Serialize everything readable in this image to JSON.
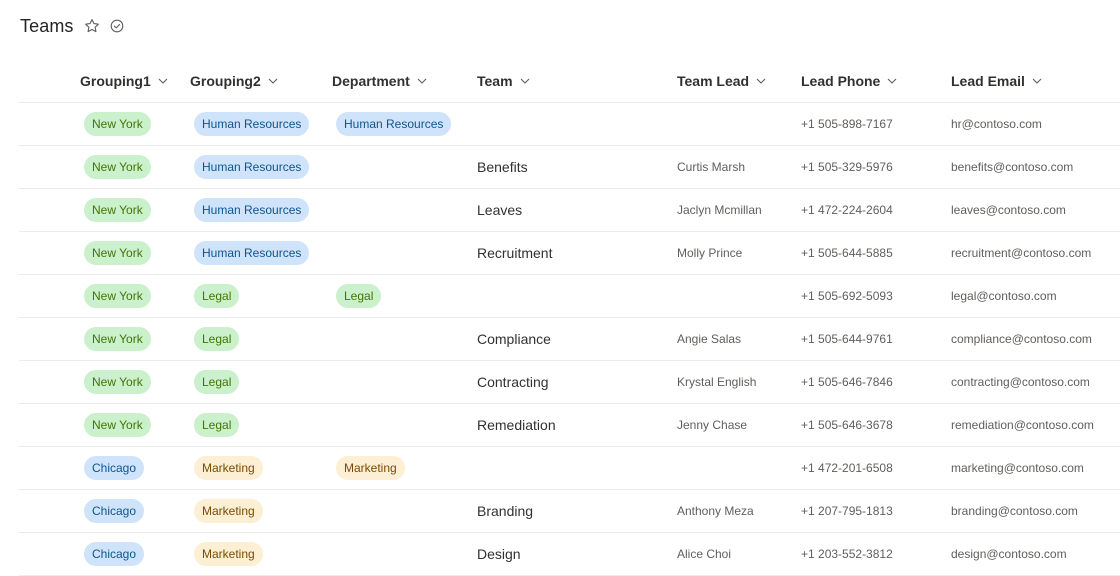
{
  "page": {
    "title": "Teams"
  },
  "columns": [
    "Grouping1",
    "Grouping2",
    "Department",
    "Team",
    "Team Lead",
    "Lead Phone",
    "Lead Email"
  ],
  "rows": [
    {
      "grouping1": {
        "text": "New York",
        "color": "green"
      },
      "grouping2": {
        "text": "Human Resources",
        "color": "blue"
      },
      "department": {
        "text": "Human Resources",
        "color": "blue"
      },
      "team": "",
      "lead": "",
      "phone": "+1 505-898-7167",
      "email": "hr@contoso.com"
    },
    {
      "grouping1": {
        "text": "New York",
        "color": "green"
      },
      "grouping2": {
        "text": "Human Resources",
        "color": "blue"
      },
      "department": null,
      "team": "Benefits",
      "lead": "Curtis Marsh",
      "phone": "+1 505-329-5976",
      "email": "benefits@contoso.com"
    },
    {
      "grouping1": {
        "text": "New York",
        "color": "green"
      },
      "grouping2": {
        "text": "Human Resources",
        "color": "blue"
      },
      "department": null,
      "team": "Leaves",
      "lead": "Jaclyn Mcmillan",
      "phone": "+1 472-224-2604",
      "email": "leaves@contoso.com"
    },
    {
      "grouping1": {
        "text": "New York",
        "color": "green"
      },
      "grouping2": {
        "text": "Human Resources",
        "color": "blue"
      },
      "department": null,
      "team": "Recruitment",
      "lead": "Molly Prince",
      "phone": "+1 505-644-5885",
      "email": "recruitment@contoso.com"
    },
    {
      "grouping1": {
        "text": "New York",
        "color": "green"
      },
      "grouping2": {
        "text": "Legal",
        "color": "green"
      },
      "department": {
        "text": "Legal",
        "color": "green"
      },
      "team": "",
      "lead": "",
      "phone": "+1 505-692-5093",
      "email": "legal@contoso.com"
    },
    {
      "grouping1": {
        "text": "New York",
        "color": "green"
      },
      "grouping2": {
        "text": "Legal",
        "color": "green"
      },
      "department": null,
      "team": "Compliance",
      "lead": "Angie Salas",
      "phone": "+1 505-644-9761",
      "email": "compliance@contoso.com"
    },
    {
      "grouping1": {
        "text": "New York",
        "color": "green"
      },
      "grouping2": {
        "text": "Legal",
        "color": "green"
      },
      "department": null,
      "team": "Contracting",
      "lead": "Krystal English",
      "phone": "+1 505-646-7846",
      "email": "contracting@contoso.com"
    },
    {
      "grouping1": {
        "text": "New York",
        "color": "green"
      },
      "grouping2": {
        "text": "Legal",
        "color": "green"
      },
      "department": null,
      "team": "Remediation",
      "lead": "Jenny Chase",
      "phone": "+1 505-646-3678",
      "email": "remediation@contoso.com"
    },
    {
      "grouping1": {
        "text": "Chicago",
        "color": "blue"
      },
      "grouping2": {
        "text": "Marketing",
        "color": "yellow"
      },
      "department": {
        "text": "Marketing",
        "color": "yellow"
      },
      "team": "",
      "lead": "",
      "phone": "+1 472-201-6508",
      "email": "marketing@contoso.com"
    },
    {
      "grouping1": {
        "text": "Chicago",
        "color": "blue"
      },
      "grouping2": {
        "text": "Marketing",
        "color": "yellow"
      },
      "department": null,
      "team": "Branding",
      "lead": "Anthony Meza",
      "phone": "+1 207-795-1813",
      "email": "branding@contoso.com"
    },
    {
      "grouping1": {
        "text": "Chicago",
        "color": "blue"
      },
      "grouping2": {
        "text": "Marketing",
        "color": "yellow"
      },
      "department": null,
      "team": "Design",
      "lead": "Alice Choi",
      "phone": "+1 203-552-3812",
      "email": "design@contoso.com"
    }
  ],
  "pill_colors": {
    "green": {
      "bg": "#caf0cc",
      "fg": "#437406"
    },
    "blue": {
      "bg": "#cfe4fa",
      "fg": "#0f548c"
    },
    "yellow": {
      "bg": "#fcefd3",
      "fg": "#7a4b00"
    }
  }
}
